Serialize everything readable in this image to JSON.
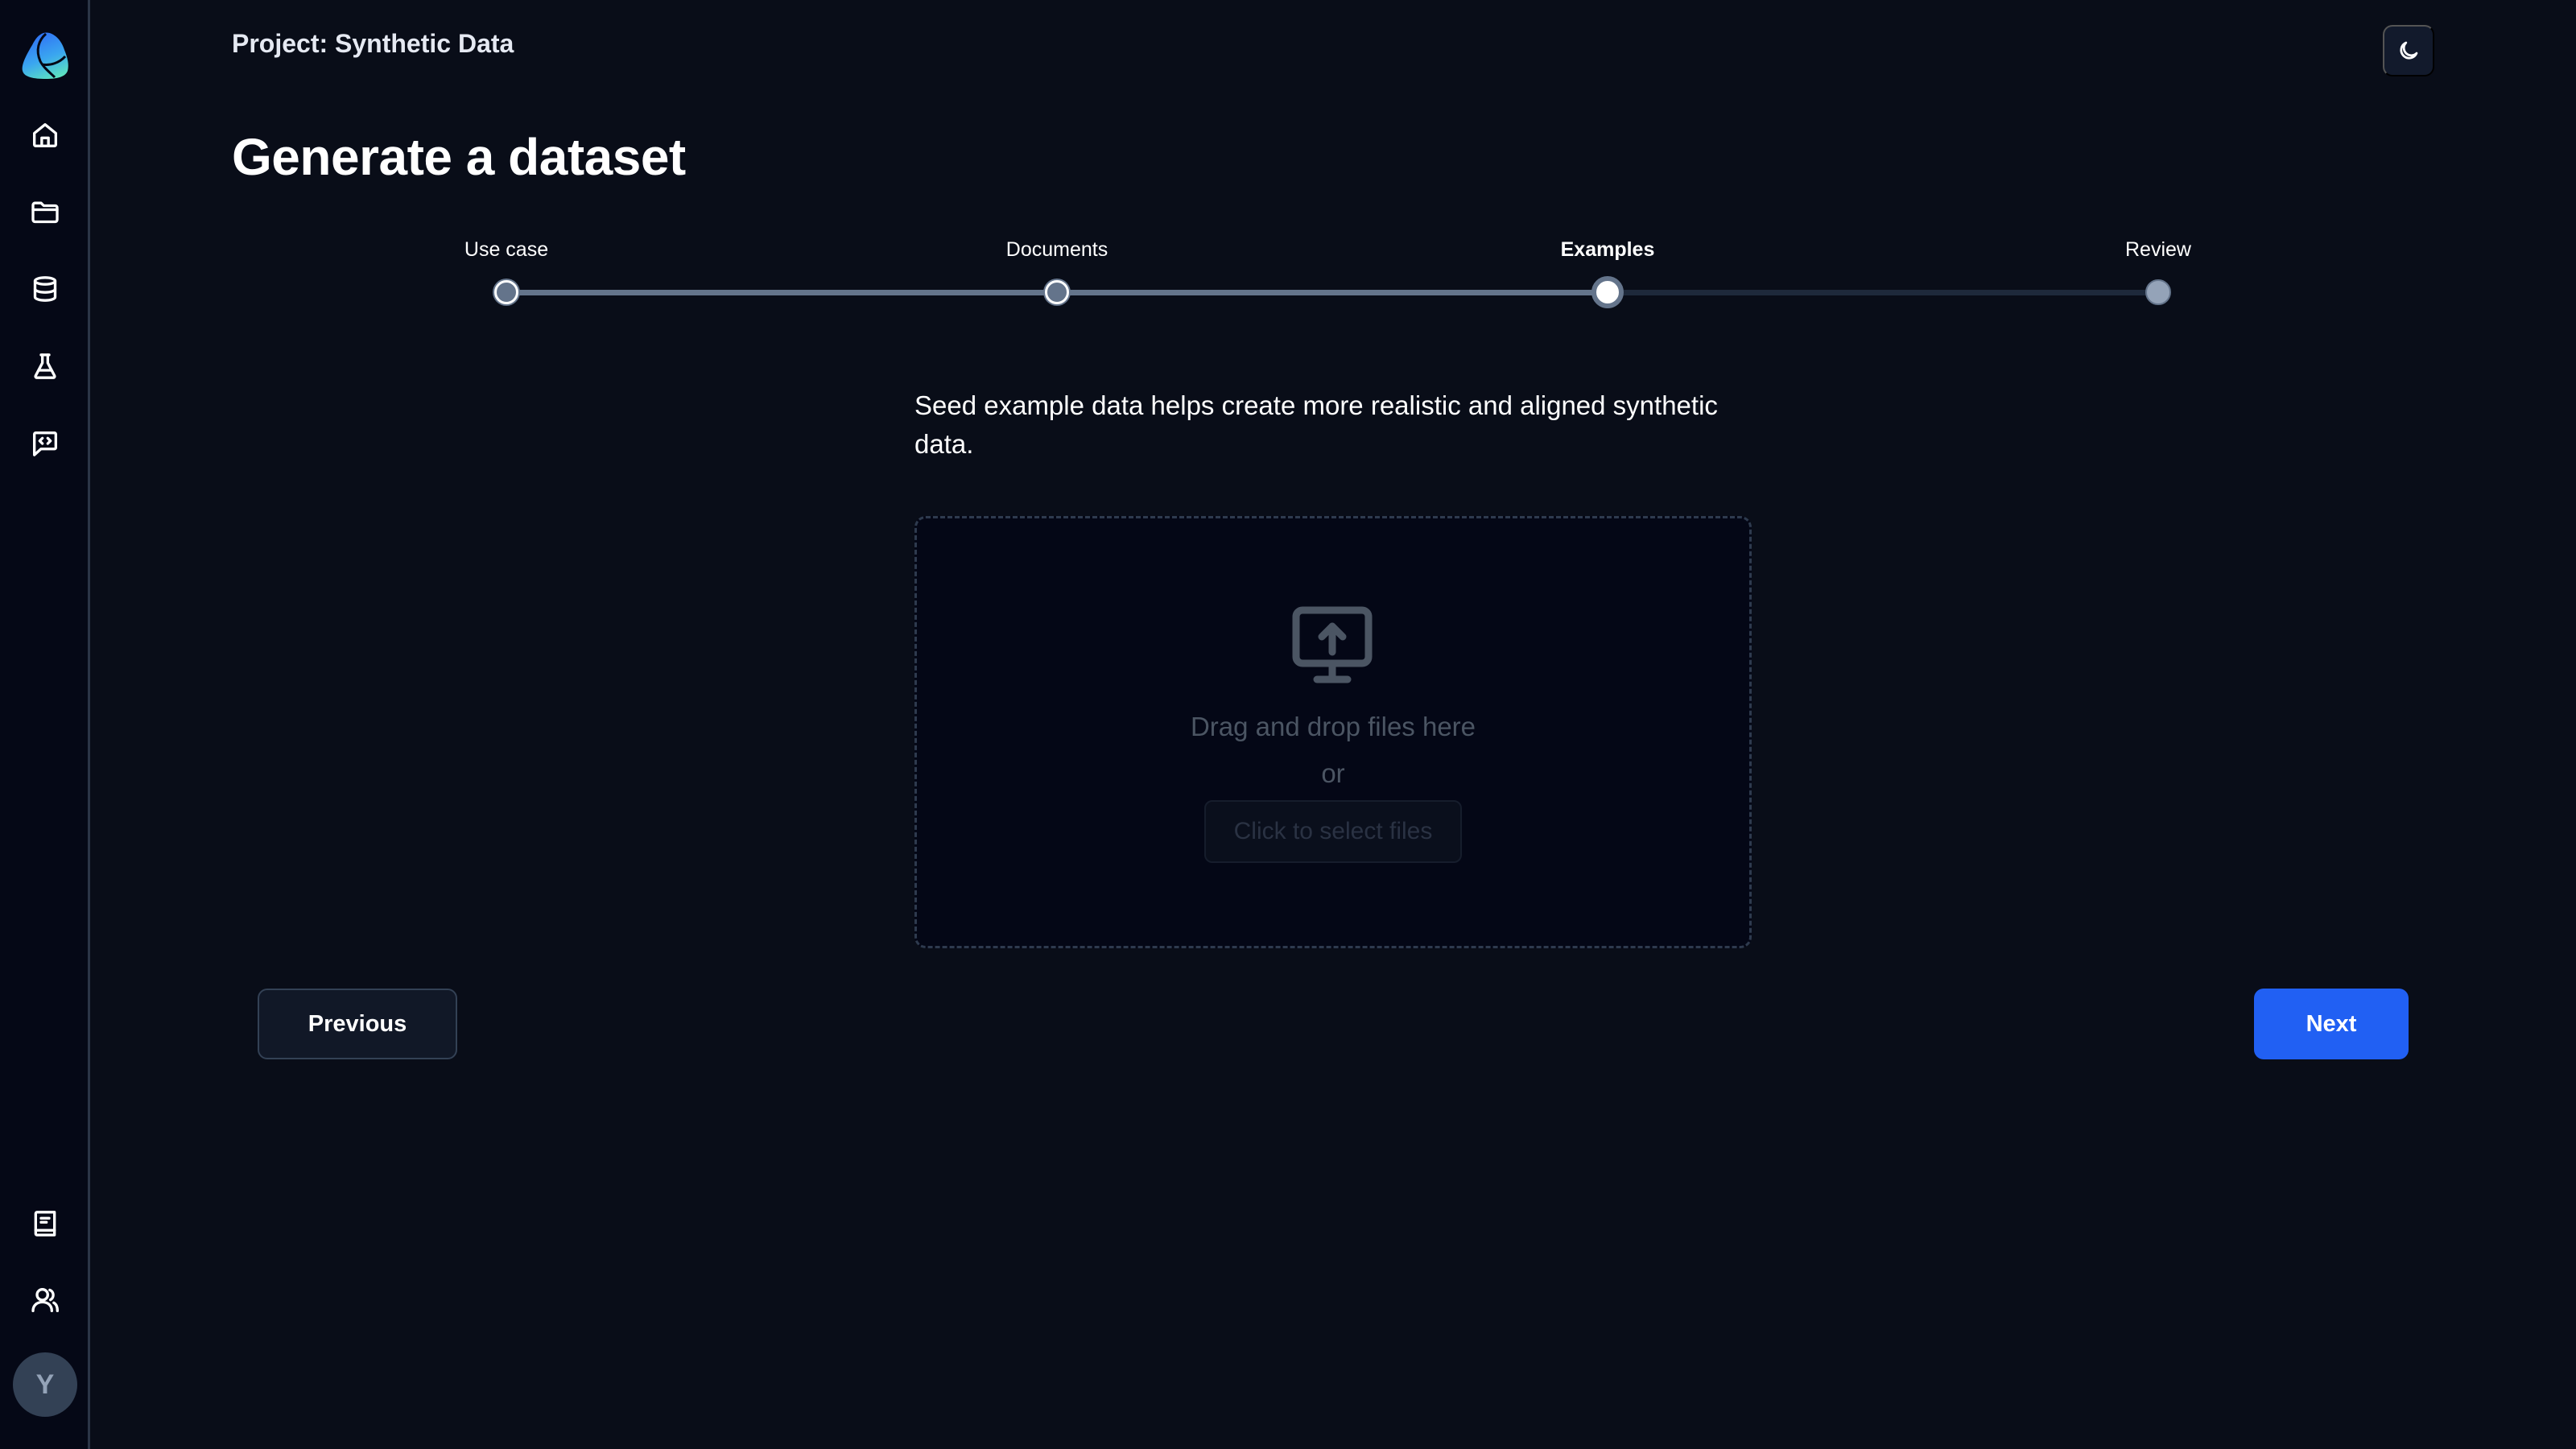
{
  "sidebar": {
    "logo": "app-logo",
    "nav_items": [
      {
        "name": "home",
        "icon": "home-icon"
      },
      {
        "name": "projects",
        "icon": "folder-icon"
      },
      {
        "name": "datasets",
        "icon": "database-icon"
      },
      {
        "name": "experiments",
        "icon": "flask-icon"
      },
      {
        "name": "prompts",
        "icon": "code-chat-icon"
      }
    ],
    "bottom_items": [
      {
        "name": "docs",
        "icon": "book-icon"
      },
      {
        "name": "team",
        "icon": "users-icon"
      }
    ],
    "avatar_initial": "Y"
  },
  "header": {
    "project_title": "Project: Synthetic Data",
    "theme_toggle_icon": "moon-icon"
  },
  "page": {
    "title": "Generate a dataset"
  },
  "stepper": {
    "current_index": 2,
    "steps": [
      {
        "label": "Use case",
        "state": "done"
      },
      {
        "label": "Documents",
        "state": "done"
      },
      {
        "label": "Examples",
        "state": "current"
      },
      {
        "label": "Review",
        "state": "todo"
      }
    ]
  },
  "examples": {
    "description": "Seed example data helps create more realistic and aligned synthetic data.",
    "dropzone": {
      "icon": "monitor-upload-icon",
      "drag_text": "Drag and drop files here",
      "or_text": "or",
      "select_button": "Click to select files"
    }
  },
  "footer": {
    "previous_label": "Previous",
    "next_label": "Next"
  },
  "colors": {
    "accent": "#2160f3",
    "background": "#090d18",
    "sidebar_background": "#050816",
    "step_done": "#64748b",
    "step_todo": "#1e293b"
  }
}
